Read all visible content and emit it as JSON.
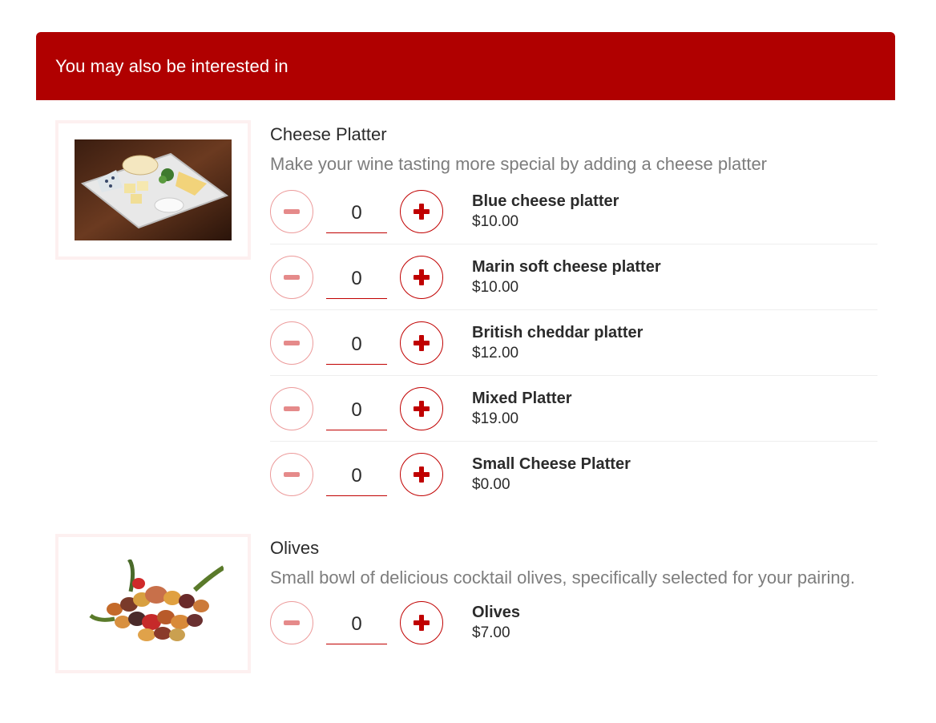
{
  "header": {
    "title": "You may also be interested in"
  },
  "products": [
    {
      "title": "Cheese Platter",
      "description": "Make your wine tasting more special by adding a cheese platter",
      "image_icon": "cheese-platter-image",
      "options": [
        {
          "name": "Blue cheese platter",
          "price": "$10.00",
          "qty": "0"
        },
        {
          "name": "Marin soft cheese platter",
          "price": "$10.00",
          "qty": "0"
        },
        {
          "name": "British cheddar platter",
          "price": "$12.00",
          "qty": "0"
        },
        {
          "name": "Mixed Platter",
          "price": "$19.00",
          "qty": "0"
        },
        {
          "name": "Small Cheese Platter",
          "price": "$0.00",
          "qty": "0"
        }
      ]
    },
    {
      "title": "Olives",
      "description": "Small bowl of delicious cocktail olives, specifically selected for your pairing.",
      "image_icon": "olives-image",
      "options": [
        {
          "name": "Olives",
          "price": "$7.00",
          "qty": "0"
        }
      ]
    }
  ],
  "colors": {
    "header_bg": "#b00000",
    "accent": "#c00000",
    "minus_light": "#ec9a9a"
  }
}
